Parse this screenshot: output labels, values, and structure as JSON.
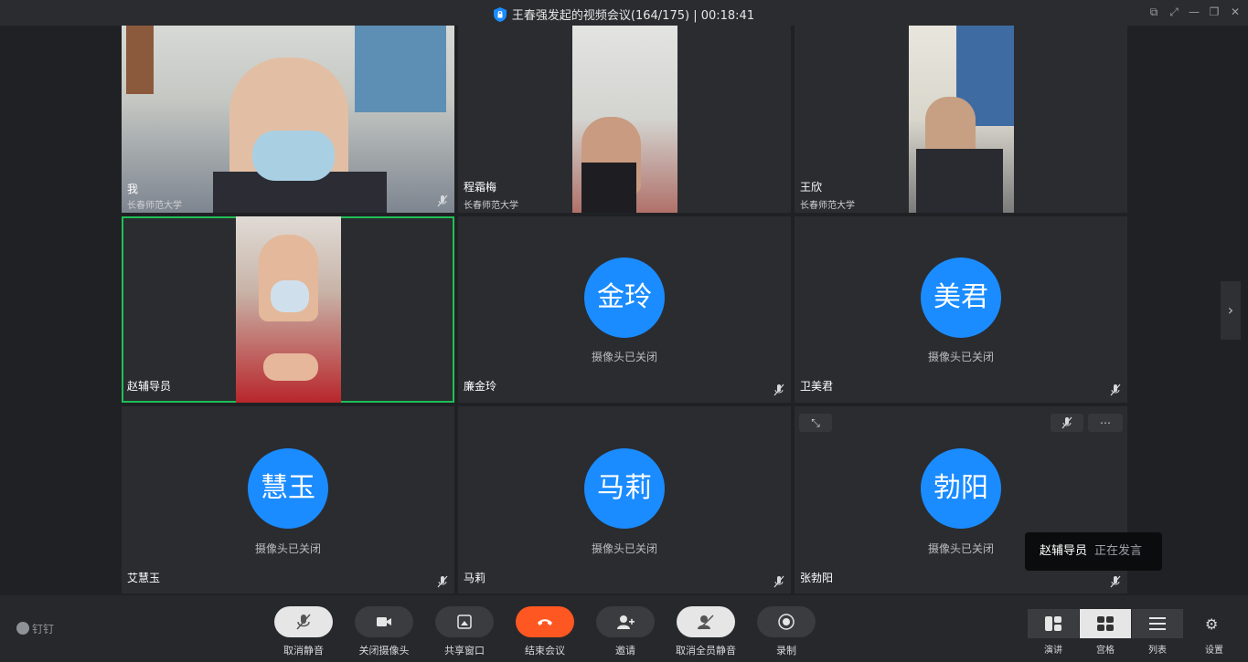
{
  "window": {
    "title": "王春强发起的视频会议(164/175) | 00:18:41"
  },
  "participants": [
    {
      "name": "我",
      "org": "长春师范大学"
    },
    {
      "name": "程霜梅",
      "org": "长春师范大学"
    },
    {
      "name": "王欣",
      "org": "长春师范大学"
    },
    {
      "name": "赵辅导员"
    },
    {
      "name": "廉金玲",
      "avatar": "金玲",
      "status": "摄像头已关闭"
    },
    {
      "name": "卫美君",
      "avatar": "美君",
      "status": "摄像头已关闭"
    },
    {
      "name": "艾慧玉",
      "avatar": "慧玉",
      "status": "摄像头已关闭"
    },
    {
      "name": "马莉",
      "avatar": "马莉",
      "status": "摄像头已关闭"
    },
    {
      "name": "张勃阳",
      "avatar": "勃阳",
      "status": "摄像头已关闭"
    }
  ],
  "speaking": {
    "name": "赵辅导员",
    "status": "正在发言"
  },
  "toolbar": {
    "brand": "钉钉",
    "unmute": "取消静音",
    "camera_off": "关闭摄像头",
    "share": "共享窗口",
    "end": "结束会议",
    "invite": "邀请",
    "unmute_all": "取消全员静音",
    "record": "录制",
    "layout_speaker": "演讲",
    "layout_grid": "宫格",
    "layout_list": "列表",
    "settings": "设置"
  },
  "colors": {
    "accent": "#1a8cff",
    "active_border": "#1fbf57",
    "end_call": "#ff5722"
  }
}
